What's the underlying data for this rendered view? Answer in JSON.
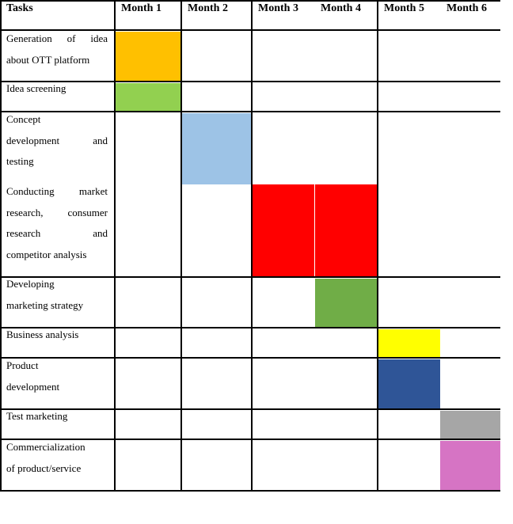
{
  "table": {
    "headers": [
      "Tasks",
      "Month 1",
      "Month 2",
      "Month 3",
      "Month 4",
      "Month 5",
      "Month 6"
    ],
    "tasks": [
      {
        "lines": [
          "Generation of idea",
          "about OTT platform"
        ],
        "months": [
          1
        ],
        "color": "#ffc000"
      },
      {
        "lines": [
          "Idea screening"
        ],
        "months": [
          1
        ],
        "color": "#92d050"
      },
      {
        "lines": [
          "Concept",
          "development and",
          "testing"
        ],
        "months": [
          2
        ],
        "color": "#9dc3e6"
      },
      {
        "lines": [
          "Conducting market",
          "research, consumer",
          "research and",
          "competitor analysis"
        ],
        "months": [
          3,
          4
        ],
        "color": "#ff0000"
      },
      {
        "lines": [
          "Developing",
          "marketing strategy"
        ],
        "months": [
          4
        ],
        "color": "#70ad47"
      },
      {
        "lines": [
          "Business analysis"
        ],
        "months": [
          5
        ],
        "color": "#ffff00"
      },
      {
        "lines": [
          "Product",
          "development"
        ],
        "months": [
          5
        ],
        "color": "#2f5597"
      },
      {
        "lines": [
          "Test marketing"
        ],
        "months": [
          6
        ],
        "color": "#a6a6a6"
      },
      {
        "lines": [
          "Commercialization",
          "of product/service"
        ],
        "months": [
          6
        ],
        "color": "#d674c4"
      }
    ]
  }
}
